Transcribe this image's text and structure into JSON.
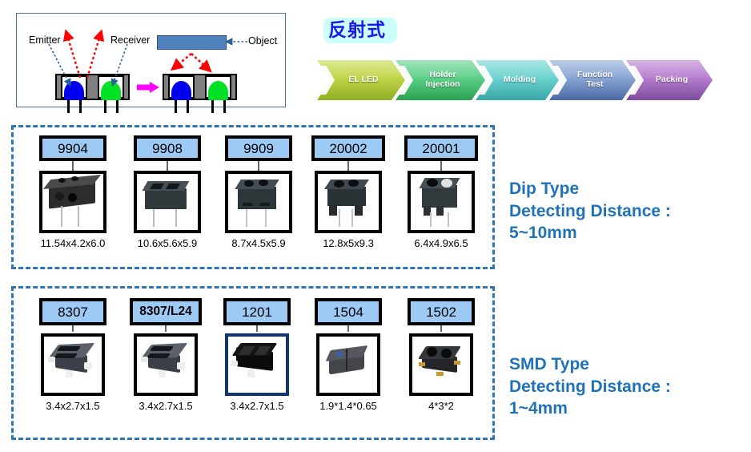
{
  "principle_diagram": {
    "emitter_label": "Emitter",
    "receiver_label": "Receiver",
    "object_label": "Object",
    "emitter_color": "#0000ee",
    "receiver_color": "#00e024",
    "object_color": "#4f81bd",
    "beam_color": "#ff0000",
    "transition_arrow_color": "#ff00ff"
  },
  "title": {
    "text": "反射式",
    "text_color": "#1a1aee",
    "background_color": "#ccfffb"
  },
  "process_flow": {
    "steps": [
      {
        "label": "EL LED",
        "color_light": "#c3d64a",
        "color_dark": "#8fae23"
      },
      {
        "label": "Holder\nInjection",
        "color_light": "#5fd18b",
        "color_dark": "#2aa24f"
      },
      {
        "label": "Molding",
        "color_light": "#6ed3cf",
        "color_dark": "#39a8a6"
      },
      {
        "label": "Function\nTest",
        "color_light": "#8ba7d6",
        "color_dark": "#4a6aa5"
      },
      {
        "label": "Packing",
        "color_light": "#b77fcf",
        "color_dark": "#7e4b9e"
      }
    ]
  },
  "groups": [
    {
      "id": "dip",
      "side_title": "Dip Type\nDetecting Distance :\n5~10mm",
      "parts": [
        {
          "tag": "9904",
          "tag_bold": false,
          "dimension": "11.54x4.2x6.0",
          "photo_accent": "#000000"
        },
        {
          "tag": "9908",
          "tag_bold": false,
          "dimension": "10.6x5.6x5.9",
          "photo_accent": "#000000"
        },
        {
          "tag": "9909",
          "tag_bold": false,
          "dimension": "8.7x4.5x5.9",
          "photo_accent": "#000000"
        },
        {
          "tag": "20002",
          "tag_bold": false,
          "dimension": "12.8x5x9.3",
          "photo_accent": "#000000"
        },
        {
          "tag": "20001",
          "tag_bold": false,
          "dimension": "6.4x4.9x6.5",
          "photo_accent": "#000000"
        }
      ]
    },
    {
      "id": "smd",
      "side_title": "SMD Type\nDetecting Distance :\n1~4mm",
      "parts": [
        {
          "tag": "8307",
          "tag_bold": false,
          "dimension": "3.4x2.7x1.5",
          "photo_accent": "#000000"
        },
        {
          "tag": "8307/L24",
          "tag_bold": true,
          "dimension": "3.4x2.7x1.5",
          "photo_accent": "#000000"
        },
        {
          "tag": "1201",
          "tag_bold": false,
          "dimension": "3.4x2.7x1.5",
          "photo_accent": "#12366b"
        },
        {
          "tag": "1504",
          "tag_bold": false,
          "dimension": "1.9*1.4*0.65",
          "photo_accent": "#000000"
        },
        {
          "tag": "1502",
          "tag_bold": false,
          "dimension": "4*3*2",
          "photo_accent": "#000000"
        }
      ]
    }
  ],
  "side_text_color": "#1f72b8",
  "group_border_color": "#2e75b6",
  "tag_fill_color": "#9dc9f5"
}
